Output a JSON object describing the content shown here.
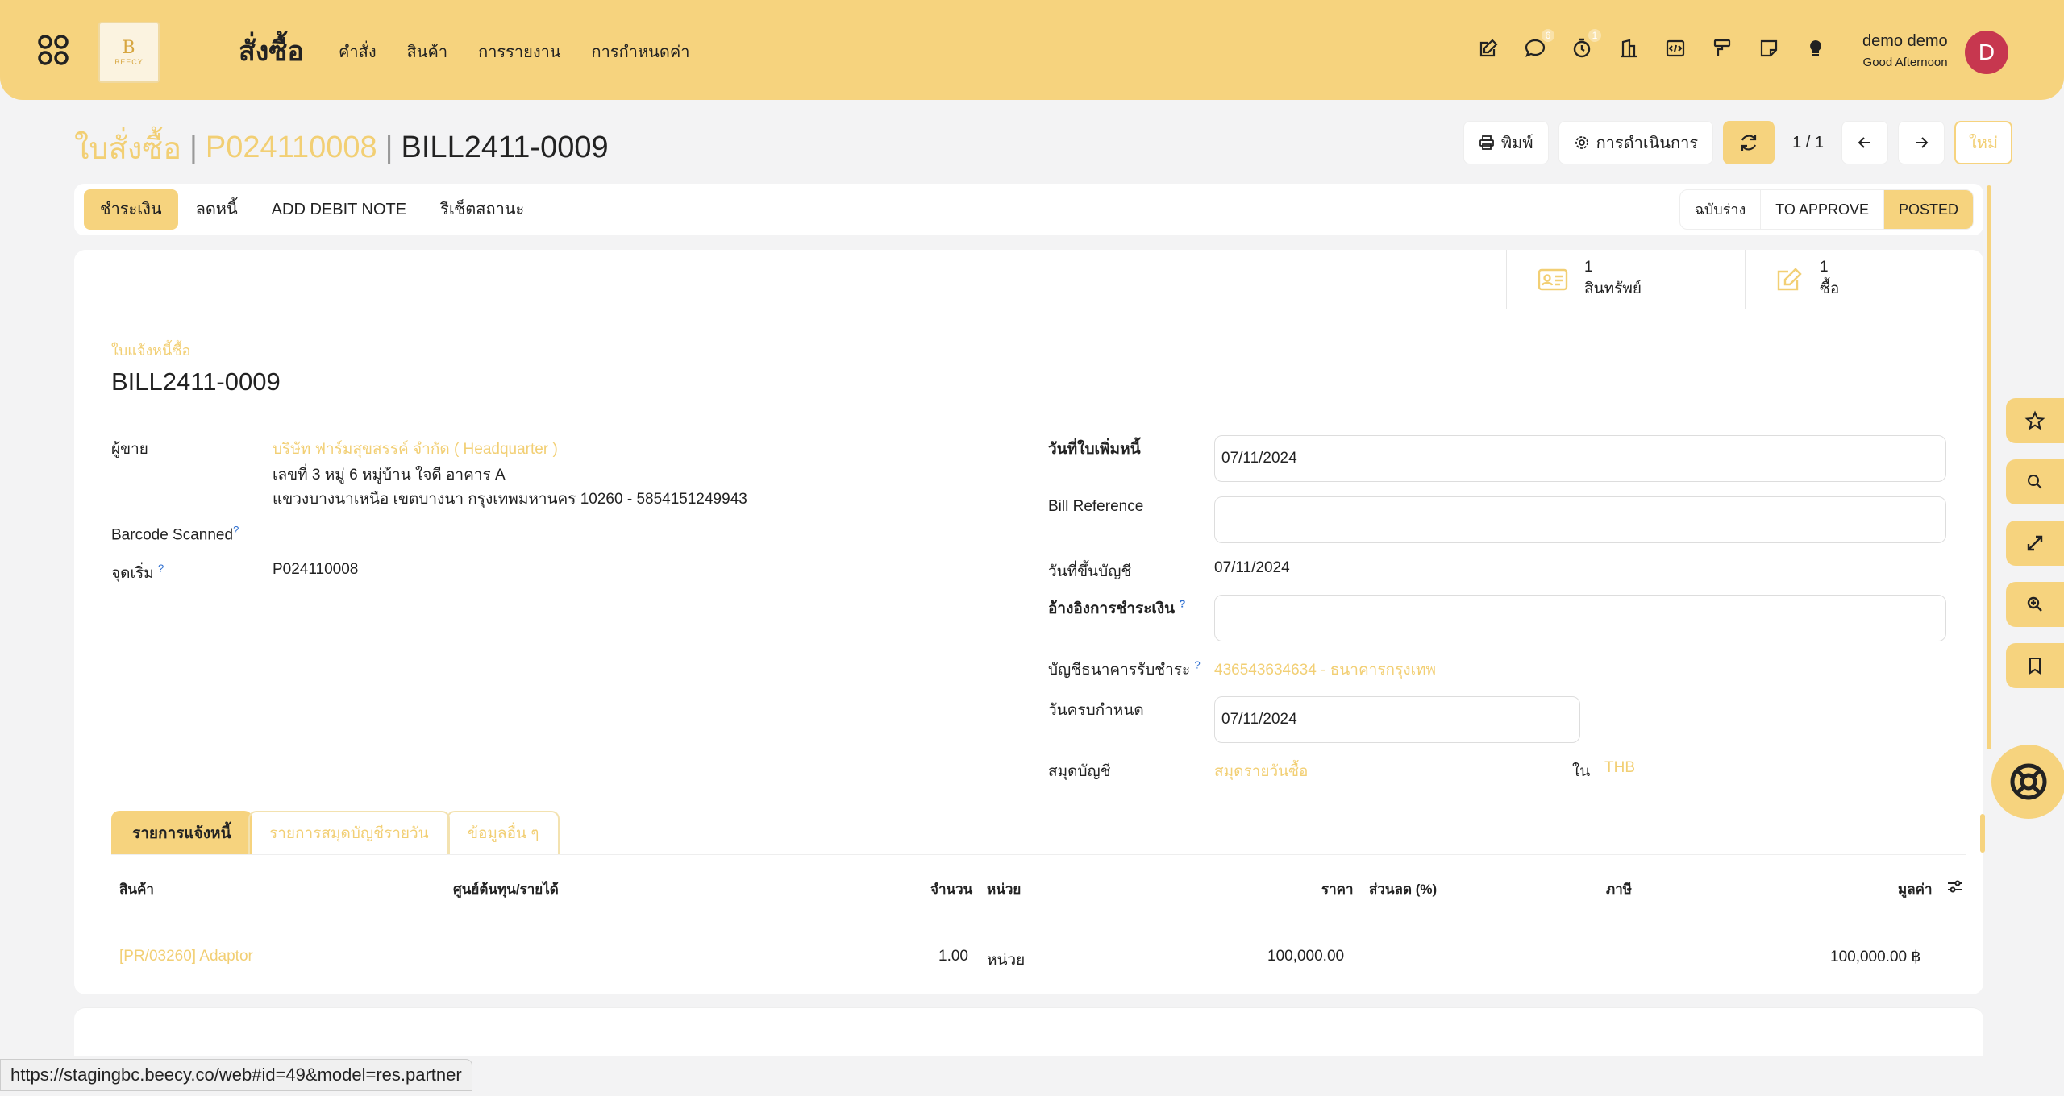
{
  "navbar": {
    "app_title": "สั่งซื้อ",
    "logo_text": "BEECY",
    "menu": [
      "คำสั่ง",
      "สินค้า",
      "การรายงาน",
      "การกำหนดค่า"
    ],
    "chat_badge": "6",
    "activity_badge": "1",
    "user_name": "demo demo",
    "user_greeting": "Good Afternoon",
    "avatar_letter": "D"
  },
  "breadcrumb": {
    "root": "ใบสั่งซื้อ",
    "parent": "P024110008",
    "current": "BILL2411-0009"
  },
  "control_panel": {
    "print_label": "พิมพ์",
    "action_label": "การดำเนินการ",
    "pager": "1 / 1",
    "new_label": "ใหม่"
  },
  "statusbar": {
    "buttons": [
      "ชำระเงิน",
      "ลดหนี้",
      "ADD DEBIT NOTE",
      "รีเซ็ตสถานะ"
    ],
    "states": [
      "ฉบับร่าง",
      "TO APPROVE",
      "POSTED"
    ]
  },
  "smart_buttons": [
    {
      "count": "1",
      "label": "สินทรัพย์",
      "icon": "id-card-icon"
    },
    {
      "count": "1",
      "label": "ซื้อ",
      "icon": "edit-icon"
    }
  ],
  "form": {
    "doc_type": "ใบแจ้งหนี้ซื้อ",
    "doc_name": "BILL2411-0009",
    "vendor_label": "ผู้ขาย",
    "vendor_name": "บริษัท ฟาร์มสุขสรรค์ จำกัด ( Headquarter )",
    "vendor_addr1": "เลขที่ 3 หมู่ 6 หมู่บ้าน ใจดี อาคาร A",
    "vendor_addr2": "แขวงบางนาเหนือ เขตบางนา กรุงเทพมหานคร 10260 - 5854151249943",
    "barcode_label": "Barcode Scanned",
    "origin_label": "จุดเริ่ม",
    "origin_value": "P024110008",
    "bill_date_label": "วันที่ใบเพิ่มหนี้",
    "bill_date_value": "07/11/2024",
    "bill_ref_label": "Bill Reference",
    "bill_ref_value": "",
    "acc_date_label": "วันที่ขึ้นบัญชี",
    "acc_date_value": "07/11/2024",
    "pay_ref_label": "อ้างอิงการชำระเงิน",
    "pay_ref_value": "",
    "bank_label": "บัญชีธนาคารรับชำระ",
    "bank_value": "436543634634 - ธนาคารกรุงเทพ",
    "due_label": "วันครบกำหนด",
    "due_value": "07/11/2024",
    "journal_label": "สมุดบัญชี",
    "journal_value": "สมุดรายวันซื้อ",
    "in_label": "ใน",
    "currency": "THB"
  },
  "tabs": [
    "รายการแจ้งหนี้",
    "รายการสมุดบัญชีรายวัน",
    "ข้อมูลอื่น ๆ"
  ],
  "table": {
    "headers": [
      "สินค้า",
      "ศูนย์ต้นทุน/รายได้",
      "จำนวน",
      "หน่วย",
      "ราคา",
      "ส่วนลด (%)",
      "ภาษี",
      "มูลค่า"
    ],
    "rows": [
      {
        "product": "[PR/03260] Adaptor",
        "qty": "1.00",
        "uom": "หน่วย",
        "price": "100,000.00",
        "subtotal": "100,000.00 ฿"
      }
    ]
  },
  "status_url": "https://stagingbc.beecy.co/web#id=49&model=res.partner"
}
